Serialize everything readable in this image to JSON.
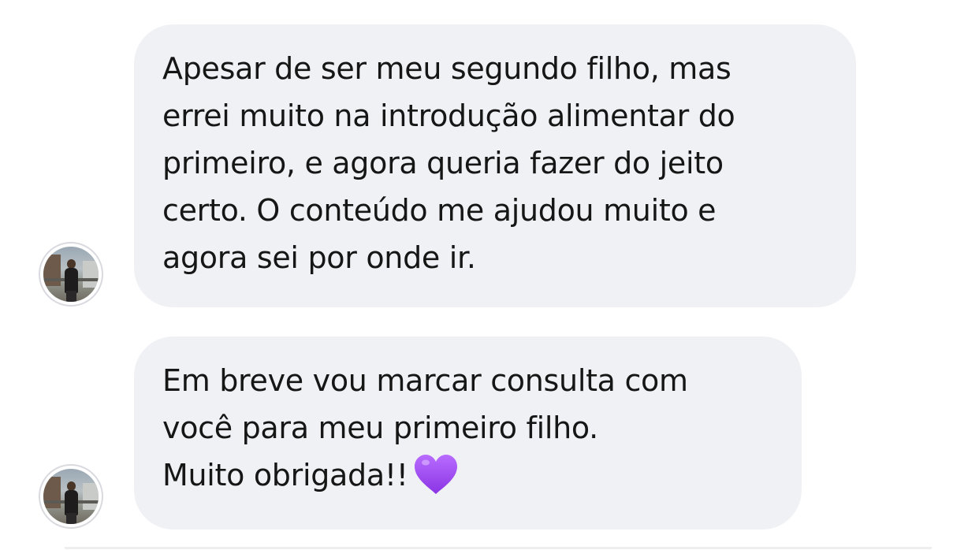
{
  "messages": [
    {
      "text": "Apesar de ser meu segundo filho, mas\nerrei muito na introdução alimentar do\nprimeiro, e agora queria fazer do jeito\ncerto. O conteúdo me ajudou muito e\nagora sei por onde ir.",
      "emoji": ""
    },
    {
      "text": "Em breve vou marcar consulta com\nvocê para meu primeiro filho.\nMuito obrigada!!",
      "emoji": "purple-heart"
    }
  ],
  "colors": {
    "bubble_bg": "#f0f1f5",
    "text": "#161616",
    "heart": "#a24ff0",
    "avatar_border": "#d9dadf"
  }
}
